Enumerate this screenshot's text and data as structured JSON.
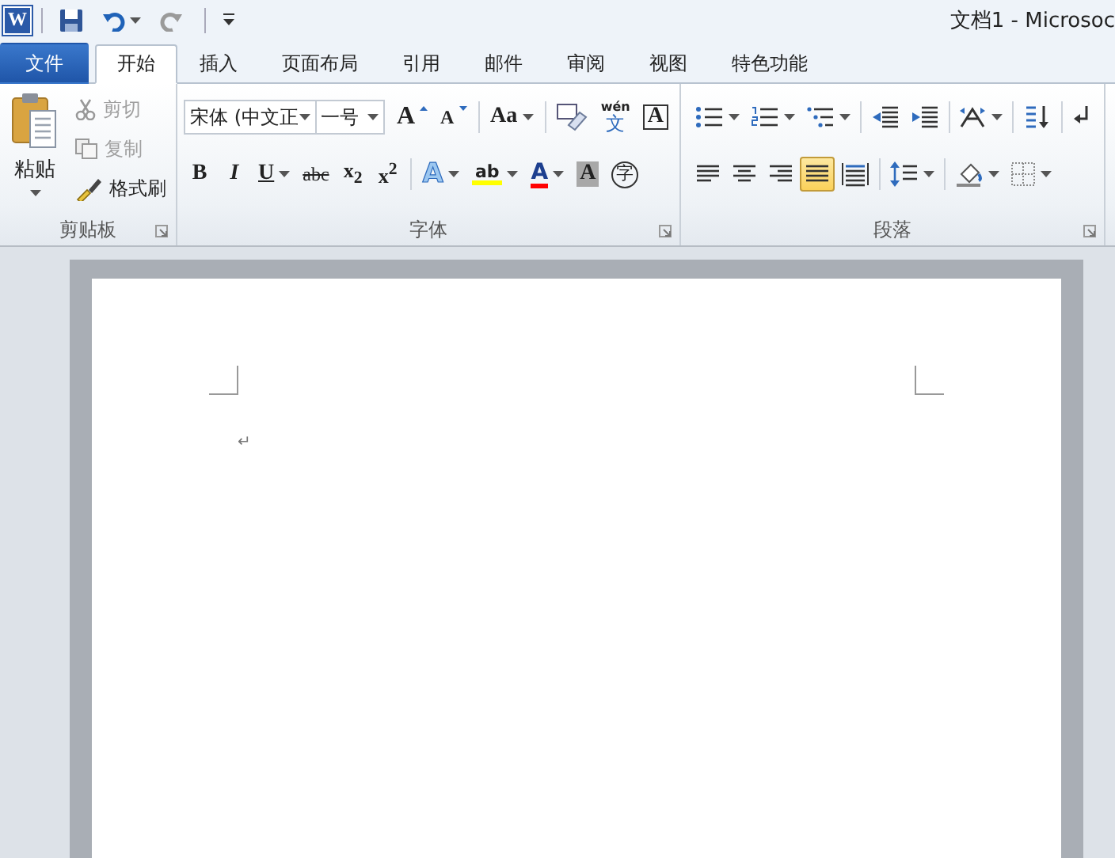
{
  "quick_access": {
    "app_label": "W"
  },
  "title": "文档1 - Microsoc",
  "tabs": [
    {
      "label": "文件",
      "kind": "file",
      "selected": false
    },
    {
      "label": "开始",
      "kind": "tab",
      "selected": true
    },
    {
      "label": "插入",
      "kind": "tab",
      "selected": false
    },
    {
      "label": "页面布局",
      "kind": "tab",
      "selected": false
    },
    {
      "label": "引用",
      "kind": "tab",
      "selected": false
    },
    {
      "label": "邮件",
      "kind": "tab",
      "selected": false
    },
    {
      "label": "审阅",
      "kind": "tab",
      "selected": false
    },
    {
      "label": "视图",
      "kind": "tab",
      "selected": false
    },
    {
      "label": "特色功能",
      "kind": "tab",
      "selected": false
    }
  ],
  "clipboard": {
    "paste": "粘贴",
    "title": "剪贴板",
    "items": [
      {
        "label": "剪切",
        "kind": "cut",
        "disabled": true
      },
      {
        "label": "复制",
        "kind": "copy",
        "disabled": true
      },
      {
        "label": "格式刷",
        "kind": "painter",
        "disabled": false
      }
    ]
  },
  "font": {
    "font_name": "宋体 (中文正",
    "font_size": "一号",
    "title": "字体",
    "row_1": [
      [
        {
          "kind": "grow",
          "label": "A",
          "menu": false
        },
        {
          "kind": "shrink",
          "label": "A",
          "menu": false
        }
      ],
      [
        {
          "kind": "case",
          "label": "Aa",
          "menu": true
        }
      ],
      [
        {
          "kind": "clear",
          "menu": false
        },
        {
          "kind": "phonetic",
          "ruby": "wén",
          "label": "文",
          "menu": false
        },
        {
          "kind": "border",
          "label": "A",
          "menu": false
        }
      ]
    ],
    "row_2": [
      [
        {
          "kind": "bold",
          "label": "B",
          "menu": false
        },
        {
          "kind": "italic",
          "label": "I",
          "menu": false
        },
        {
          "kind": "underline",
          "label": "U",
          "menu": true
        },
        {
          "kind": "strike",
          "label": "abc",
          "menu": false
        },
        {
          "kind": "sub",
          "label": "x$_{2}$",
          "menu": false
        },
        {
          "kind": "sup",
          "label": "x$^{2}$",
          "menu": false
        }
      ],
      [
        {
          "kind": "effect",
          "label": "A",
          "menu": true
        },
        {
          "kind": "highlight",
          "label": "ab",
          "menu": true
        },
        {
          "kind": "color",
          "label": "A",
          "menu": true
        },
        {
          "kind": "shading",
          "label": "A",
          "menu": false
        },
        {
          "kind": "enclose",
          "label": "字",
          "menu": false
        }
      ]
    ]
  },
  "paragraph": {
    "title": "段落",
    "row_1": [
      [
        {
          "kind": "bullets",
          "menu": true
        },
        {
          "kind": "numbering",
          "menu": true
        },
        {
          "kind": "multilevel",
          "menu": true
        }
      ],
      [
        {
          "kind": "outdent",
          "menu": false
        },
        {
          "kind": "indent",
          "menu": false
        }
      ],
      [
        {
          "kind": "asian",
          "menu": true
        }
      ],
      [
        {
          "kind": "sort",
          "menu": false
        }
      ],
      [
        {
          "kind": "marks",
          "menu": false
        }
      ]
    ],
    "row_2": [
      [
        {
          "kind": "left",
          "menu": false,
          "selected": false
        },
        {
          "kind": "center",
          "menu": false,
          "selected": false
        },
        {
          "kind": "right",
          "menu": false,
          "selected": false
        },
        {
          "kind": "justify",
          "menu": false,
          "selected": true
        },
        {
          "kind": "distribute",
          "menu": false,
          "selected": false
        }
      ],
      [
        {
          "kind": "spacing",
          "menu": true
        }
      ],
      [
        {
          "kind": "fill",
          "menu": true
        },
        {
          "kind": "borders",
          "menu": true
        }
      ]
    ]
  },
  "document": {
    "paragraph_mark": "↵"
  }
}
